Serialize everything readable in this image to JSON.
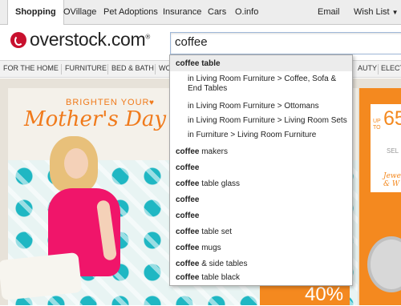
{
  "topnav": {
    "tabs": [
      "Shopping",
      "OVillage",
      "Pet Adoptions",
      "Insurance",
      "Cars",
      "O.info"
    ],
    "email": "Email",
    "wish_list": "Wish List"
  },
  "header": {
    "logo": "overstock.com",
    "logo_mark": "®",
    "search_value": "coffee"
  },
  "categories": [
    "FOR THE HOME",
    "FURNITURE",
    "BED & BATH",
    "WO",
    "AUTY",
    "ELECT"
  ],
  "banner": {
    "bright": "BRIGHTEN YOUR",
    "mothers_day": "Mother's Day",
    "up_to": "UP TO",
    "percent": "65",
    "sel": "SEL",
    "jewelry": "Jewel & W",
    "bottom_percent": "40%"
  },
  "dropdown": {
    "items": [
      {
        "bold": "coffee table",
        "rest": "",
        "type": "head"
      },
      {
        "bold": "",
        "rest": "in Living Room Furniture > Coffee, Sofa & End Tables",
        "type": "sub"
      },
      {
        "bold": "",
        "rest": "in Living Room Furniture > Ottomans",
        "type": "sub"
      },
      {
        "bold": "",
        "rest": "in Living Room Furniture > Living Room Sets",
        "type": "sub"
      },
      {
        "bold": "",
        "rest": "in Furniture > Living Room Furniture",
        "type": "sub"
      },
      {
        "bold": "coffee",
        "rest": " makers",
        "type": "item"
      },
      {
        "bold": "coffee",
        "rest": "",
        "type": "item"
      },
      {
        "bold": "coffee",
        "rest": " table glass",
        "type": "item"
      },
      {
        "bold": "coffee",
        "rest": "",
        "type": "item"
      },
      {
        "bold": "coffee",
        "rest": "",
        "type": "item"
      },
      {
        "bold": "coffee",
        "rest": " table set",
        "type": "item"
      },
      {
        "bold": "coffee",
        "rest": " mugs",
        "type": "item"
      },
      {
        "bold": "coffee",
        "rest": " & side tables",
        "type": "item"
      },
      {
        "bold": "coffee",
        "rest": " table black",
        "type": "item"
      }
    ]
  },
  "colors": {
    "brand_red": "#c8102e",
    "accent_orange": "#f07a1b"
  }
}
